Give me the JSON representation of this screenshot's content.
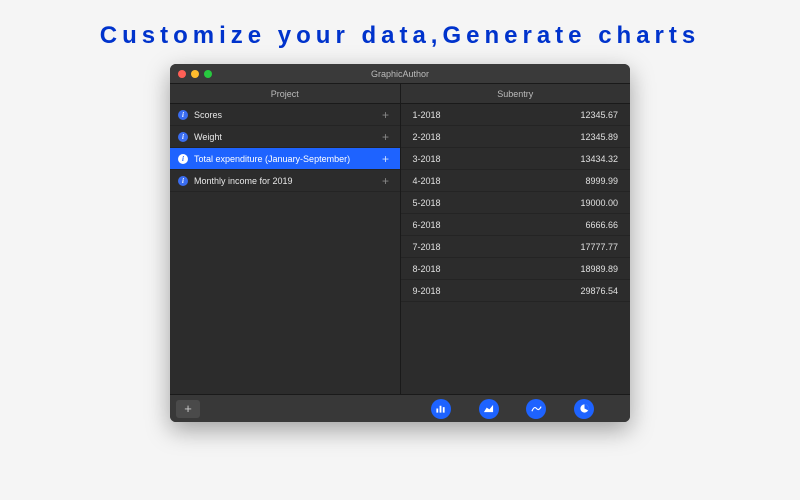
{
  "tagline": "Customize your data,Generate charts",
  "window": {
    "title": "GraphicAuthor",
    "columns": {
      "project": "Project",
      "subentry": "Subentry"
    }
  },
  "projects": [
    {
      "label": "Scores",
      "selected": false
    },
    {
      "label": "Weight",
      "selected": false
    },
    {
      "label": "Total expenditure (January-September)",
      "selected": true
    },
    {
      "label": "Monthly income for 2019",
      "selected": false
    }
  ],
  "subentries": [
    {
      "label": "1-2018",
      "value": "12345.67"
    },
    {
      "label": "2-2018",
      "value": "12345.89"
    },
    {
      "label": "3-2018",
      "value": "13434.32"
    },
    {
      "label": "4-2018",
      "value": "8999.99"
    },
    {
      "label": "5-2018",
      "value": "19000.00"
    },
    {
      "label": "6-2018",
      "value": "6666.66"
    },
    {
      "label": "7-2018",
      "value": "17777.77"
    },
    {
      "label": "8-2018",
      "value": "18989.89"
    },
    {
      "label": "9-2018",
      "value": "29876.54"
    }
  ],
  "footer": {
    "add_glyph": "+"
  },
  "glyphs": {
    "info": "i",
    "plus": "+"
  }
}
